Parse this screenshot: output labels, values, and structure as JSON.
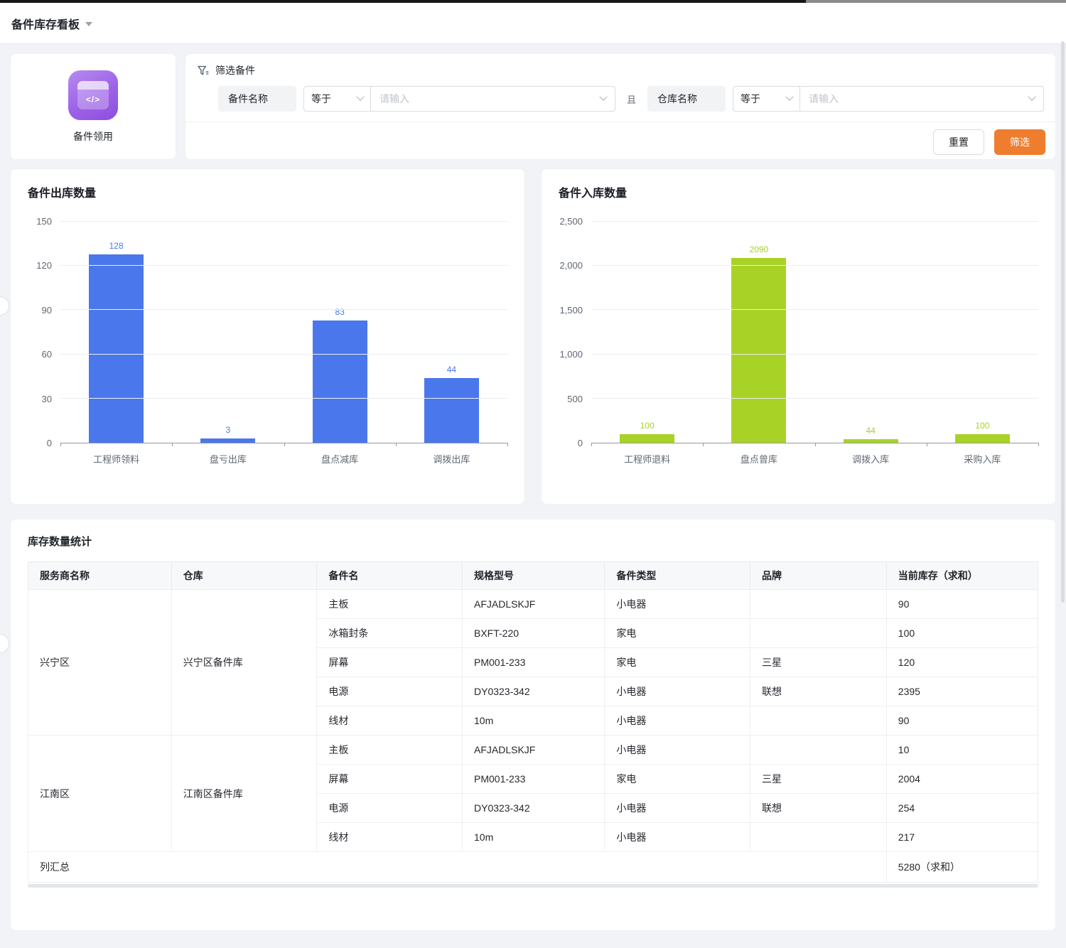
{
  "header": {
    "title": "备件库存看板"
  },
  "app_card": {
    "label": "备件领用",
    "icon_symbol": "</>"
  },
  "filter": {
    "title": "筛选备件",
    "joiner": "且",
    "conditions": [
      {
        "field": "备件名称",
        "operator": "等于",
        "placeholder": "请输入"
      },
      {
        "field": "仓库名称",
        "operator": "等于",
        "placeholder": "请输入"
      }
    ],
    "reset_label": "重置",
    "submit_label": "筛选"
  },
  "chart_data": [
    {
      "type": "bar",
      "title": "备件出库数量",
      "categories": [
        "工程师领料",
        "盘亏出库",
        "盘点减库",
        "调拨出库"
      ],
      "values": [
        128,
        3,
        83,
        44
      ],
      "ylim": [
        0,
        150
      ],
      "ytick_step": 30,
      "bar_color": "#4b77ec",
      "grid": true,
      "value_labels": true,
      "xlabel": "",
      "ylabel": ""
    },
    {
      "type": "bar",
      "title": "备件入库数量",
      "categories": [
        "工程师退料",
        "盘点曾库",
        "调拨入库",
        "采购入库"
      ],
      "values": [
        100,
        2090,
        44,
        100
      ],
      "ylim": [
        0,
        2500
      ],
      "ytick_step": 500,
      "bar_color": "#a9d226",
      "grid": true,
      "value_labels": true,
      "xlabel": "",
      "ylabel": ""
    }
  ],
  "table": {
    "title": "库存数量统计",
    "columns": [
      "服务商名称",
      "仓库",
      "备件名",
      "规格型号",
      "备件类型",
      "品牌",
      "当前库存（求和）"
    ],
    "groups": [
      {
        "provider": "兴宁区",
        "warehouse": "兴宁区备件库",
        "rows": [
          [
            "主板",
            "AFJADLSKJF",
            "小电器",
            "",
            "90"
          ],
          [
            "冰箱封条",
            "BXFT-220",
            "家电",
            "",
            "100"
          ],
          [
            "屏幕",
            "PM001-233",
            "家电",
            "三星",
            "120"
          ],
          [
            "电源",
            "DY0323-342",
            "小电器",
            "联想",
            "2395"
          ],
          [
            "线材",
            "10m",
            "小电器",
            "",
            "90"
          ]
        ]
      },
      {
        "provider": "江南区",
        "warehouse": "江南区备件库",
        "rows": [
          [
            "主板",
            "AFJADLSKJF",
            "小电器",
            "",
            "10"
          ],
          [
            "屏幕",
            "PM001-233",
            "家电",
            "三星",
            "2004"
          ],
          [
            "电源",
            "DY0323-342",
            "小电器",
            "联想",
            "254"
          ],
          [
            "线材",
            "10m",
            "小电器",
            "",
            "217"
          ]
        ]
      }
    ],
    "summary": {
      "label": "列汇总",
      "value": "5280（求和）"
    }
  },
  "colors": {
    "accent_orange": "#ef7d2e",
    "outbound_bar": "#4b77ec",
    "inbound_bar": "#a9d226",
    "page_background": "#f1f3f7"
  }
}
